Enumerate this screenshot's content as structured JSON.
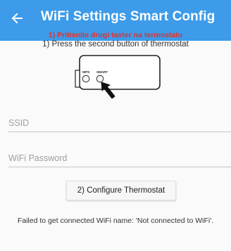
{
  "header": {
    "title": "WiFi Settings Smart Config",
    "back_icon": "arrow-left-icon",
    "background": "#3d9be9"
  },
  "instructions": {
    "step1_local": "1) Pritisnite drugi taster na termostatu",
    "step1": "1) Press the second button of thermostat"
  },
  "device_image": {
    "label_wps": "WPS",
    "label_smart": "SMART",
    "pointer_icon": "arrow-cursor-icon"
  },
  "form": {
    "ssid_placeholder": "SSID",
    "ssid_value": "",
    "password_placeholder": "WiFi Password",
    "password_value": ""
  },
  "actions": {
    "configure_label": "2) Configure Thermostat"
  },
  "status": {
    "message": "Failed to get connected WiFi name: 'Not connected to WiFi'."
  },
  "colors": {
    "accent": "#3d9be9",
    "warning_red": "#e2322c"
  }
}
